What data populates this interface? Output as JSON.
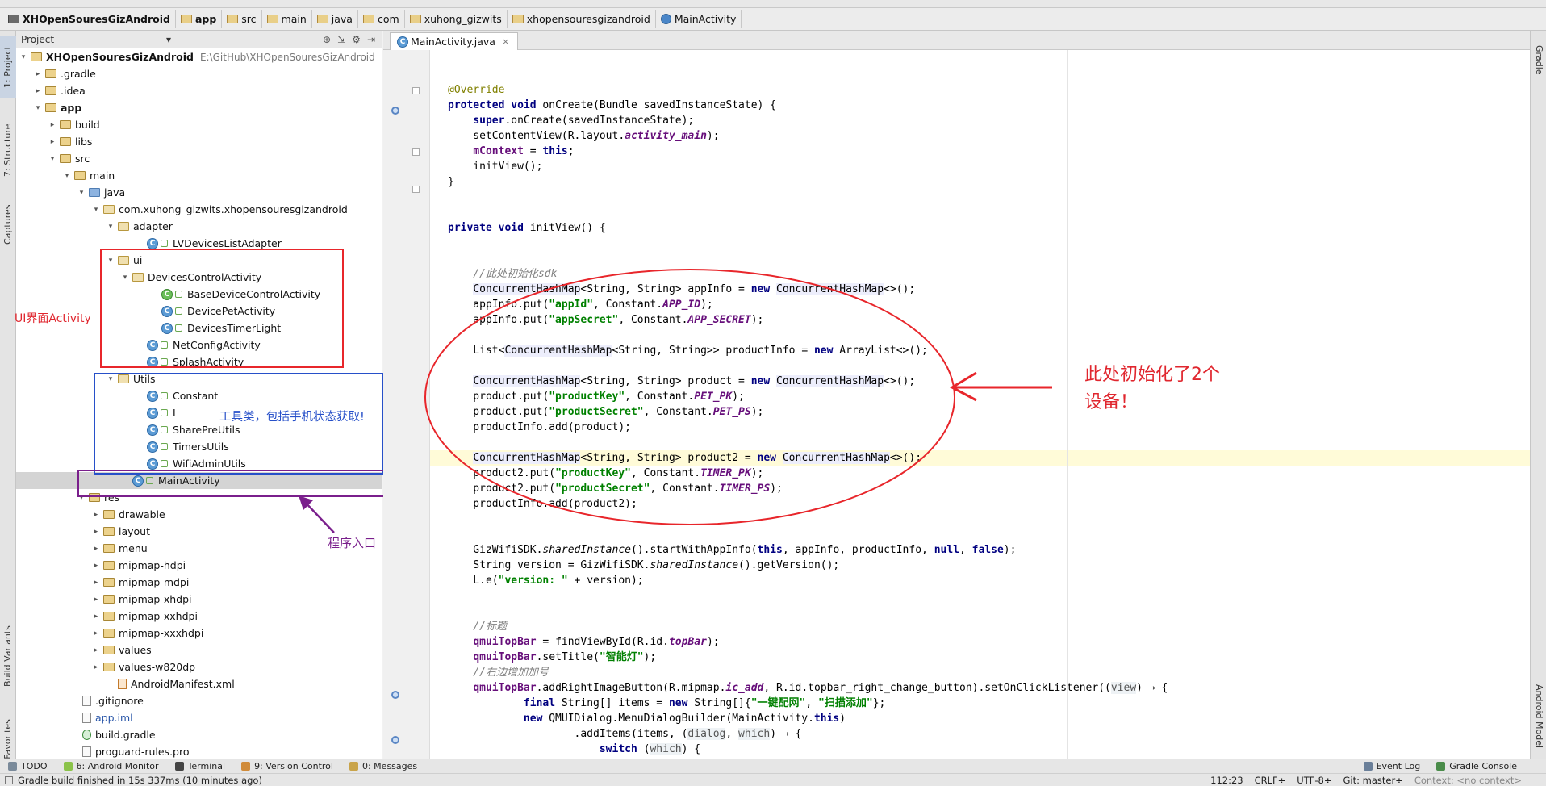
{
  "breadcrumbs": [
    "XHOpenSouresGizAndroid",
    "app",
    "src",
    "main",
    "java",
    "com",
    "xuhong_gizwits",
    "xhopensouresgizandroid",
    "MainActivity"
  ],
  "project_panel": {
    "selector_label": "Project",
    "tree": [
      {
        "label": "XHOpenSouresGizAndroid",
        "hint": "E:\\GitHub\\XHOpenSouresGizAndroid"
      },
      {
        "label": ".gradle"
      },
      {
        "label": ".idea"
      },
      {
        "label": "app"
      },
      {
        "label": "build"
      },
      {
        "label": "libs"
      },
      {
        "label": "src"
      },
      {
        "label": "main"
      },
      {
        "label": "java"
      },
      {
        "label": "com.xuhong_gizwits.xhopensouresgizandroid"
      },
      {
        "label": "adapter"
      },
      {
        "label": "LVDevicesListAdapter"
      },
      {
        "label": "ui"
      },
      {
        "label": "DevicesControlActivity"
      },
      {
        "label": "BaseDeviceControlActivity"
      },
      {
        "label": "DevicePetActivity"
      },
      {
        "label": "DevicesTimerLight"
      },
      {
        "label": "NetConfigActivity"
      },
      {
        "label": "SplashActivity"
      },
      {
        "label": "Utils"
      },
      {
        "label": "Constant"
      },
      {
        "label": "L"
      },
      {
        "label": "SharePreUtils"
      },
      {
        "label": "TimersUtils"
      },
      {
        "label": "WifiAdminUtils"
      },
      {
        "label": "MainActivity"
      },
      {
        "label": "res"
      },
      {
        "label": "drawable"
      },
      {
        "label": "layout"
      },
      {
        "label": "menu"
      },
      {
        "label": "mipmap-hdpi"
      },
      {
        "label": "mipmap-mdpi"
      },
      {
        "label": "mipmap-xhdpi"
      },
      {
        "label": "mipmap-xxhdpi"
      },
      {
        "label": "mipmap-xxxhdpi"
      },
      {
        "label": "values"
      },
      {
        "label": "values-w820dp"
      },
      {
        "label": "AndroidManifest.xml"
      },
      {
        "label": ".gitignore"
      },
      {
        "label": "app.iml"
      },
      {
        "label": "build.gradle"
      },
      {
        "label": "proguard-rules.pro"
      }
    ]
  },
  "left_tabs": [
    "1: Project",
    "7: Structure",
    "Captures",
    "Build Variants",
    "2: Favorites"
  ],
  "right_tabs": [
    "Gradle",
    "Android Model"
  ],
  "editor_tab": "MainActivity.java",
  "annotations": {
    "ui_label": "UI界面Activity",
    "utils_label": "工具类，包括手机状态获取!",
    "entry_label": "程序入口",
    "init_line1": "此处初始化了2个",
    "init_line2": "设备！"
  },
  "code": [
    "",
    "",
    "@Override",
    "protected void onCreate(Bundle savedInstanceState) {",
    "    super.onCreate(savedInstanceState);",
    "    setContentView(R.layout.activity_main);",
    "    mContext = this;",
    "    initView();",
    "}",
    "",
    "",
    "private void initView() {",
    "",
    "",
    "    //此处初始化sdk",
    "    ConcurrentHashMap<String, String> appInfo = new ConcurrentHashMap<>();",
    "    appInfo.put(\"appId\", Constant.APP_ID);",
    "    appInfo.put(\"appSecret\", Constant.APP_SECRET);",
    "",
    "    List<ConcurrentHashMap<String, String>> productInfo = new ArrayList<>();",
    "",
    "    ConcurrentHashMap<String, String> product = new ConcurrentHashMap<>();",
    "    product.put(\"productKey\", Constant.PET_PK);",
    "    product.put(\"productSecret\", Constant.PET_PS);",
    "    productInfo.add(product);",
    "",
    "    ConcurrentHashMap<String, String> product2 = new ConcurrentHashMap<>();",
    "    product2.put(\"productKey\", Constant.TIMER_PK);",
    "    product2.put(\"productSecret\", Constant.TIMER_PS);",
    "    productInfo.add(product2);",
    "",
    "",
    "    GizWifiSDK.sharedInstance().startWithAppInfo(this, appInfo, productInfo, null, false);",
    "    String version = GizWifiSDK.sharedInstance().getVersion();",
    "    L.e(\"version: \" + version);",
    "",
    "",
    "    //标题",
    "    qmuiTopBar = findViewById(R.id.topBar);",
    "    qmuiTopBar.setTitle(\"智能灯\");",
    "    //右边增加加号",
    "    qmuiTopBar.addRightImageButton(R.mipmap.ic_add, R.id.topbar_right_change_button).setOnClickListener((view) → {",
    "            final String[] items = new String[]{\"一键配网\", \"扫描添加\"};",
    "            new QMUIDialog.MenuDialogBuilder(MainActivity.this)",
    "                    .addItems(items, (dialog, which) → {",
    "                        switch (which) {"
  ],
  "bottom_tabs": [
    "TODO",
    "6: Android Monitor",
    "Terminal",
    "9: Version Control",
    "0: Messages"
  ],
  "bottom_right_tabs": [
    "Event Log",
    "Gradle Console"
  ],
  "status": {
    "message": "Gradle build finished in 15s 337ms (10 minutes ago)",
    "position": "112:23",
    "line_sep": "CRLF÷",
    "encoding": "UTF-8÷",
    "git": "Git: master÷",
    "context": "Context: <no context>"
  },
  "colors": {
    "red_box": "#e8262b",
    "blue_box": "#2750c9",
    "purple_box": "#7a1f8c",
    "annotation_red": "#e0262e"
  }
}
